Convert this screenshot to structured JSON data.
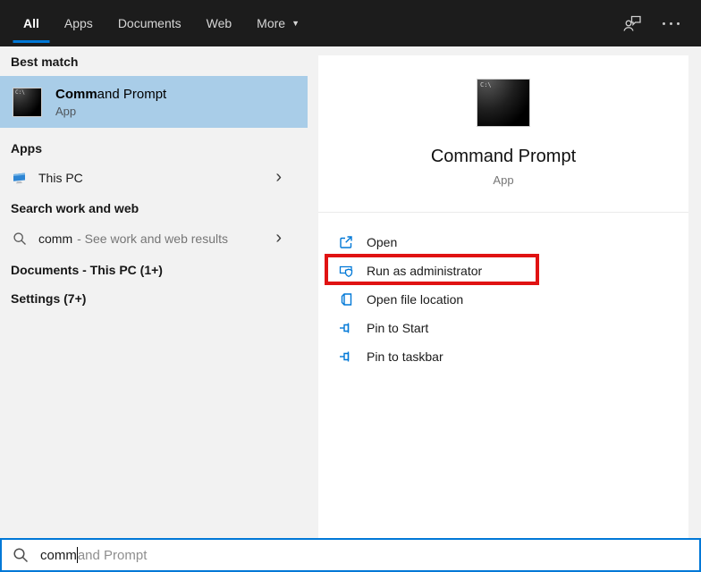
{
  "topbar": {
    "tabs": [
      {
        "label": "All",
        "active": true
      },
      {
        "label": "Apps",
        "active": false
      },
      {
        "label": "Documents",
        "active": false
      },
      {
        "label": "Web",
        "active": false
      },
      {
        "label": "More",
        "active": false,
        "has_dropdown": true
      }
    ],
    "dropdown_arrow": "▼"
  },
  "left": {
    "best_match_heading": "Best match",
    "best_match": {
      "title_bold": "Comm",
      "title_rest": "and Prompt",
      "subtitle": "App",
      "icon_text": "C:\\"
    },
    "apps_heading": "Apps",
    "this_pc_label": "This PC",
    "search_web_heading": "Search work and web",
    "web_row": {
      "query": "comm",
      "suffix": " - See work and web results"
    },
    "documents_heading": "Documents - This PC (1+)",
    "settings_heading": "Settings (7+)",
    "chevron": "›"
  },
  "preview": {
    "title": "Command Prompt",
    "subtitle": "App",
    "icon_text": "C:\\",
    "actions": [
      {
        "label": "Open"
      },
      {
        "label": "Run as administrator",
        "highlighted": true
      },
      {
        "label": "Open file location"
      },
      {
        "label": "Pin to Start"
      },
      {
        "label": "Pin to taskbar"
      }
    ]
  },
  "searchbar": {
    "typed": "comm",
    "suggestion": "and Prompt"
  },
  "colors": {
    "accent": "#0078d7",
    "best_match_highlight": "#a9cde8",
    "annotation_red": "#e01212",
    "topbar_bg": "#1c1c1c",
    "panel_bg": "#f2f2f2"
  }
}
